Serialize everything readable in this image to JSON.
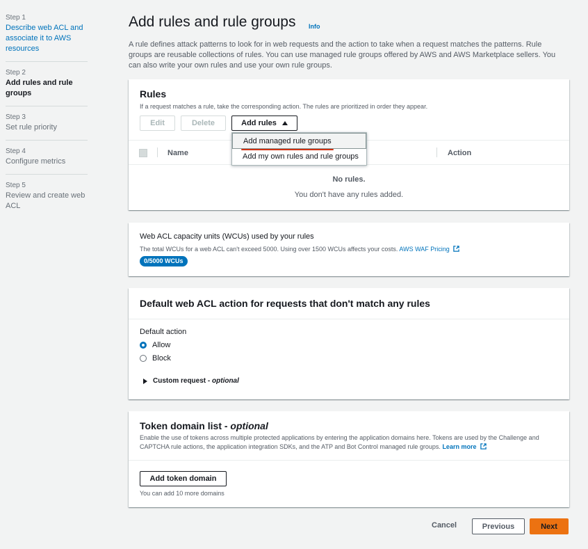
{
  "sidebar": {
    "steps": [
      {
        "num": "Step 1",
        "label": "Describe web ACL and associate it to AWS resources"
      },
      {
        "num": "Step 2",
        "label": "Add rules and rule groups"
      },
      {
        "num": "Step 3",
        "label": "Set rule priority"
      },
      {
        "num": "Step 4",
        "label": "Configure metrics"
      },
      {
        "num": "Step 5",
        "label": "Review and create web ACL"
      }
    ]
  },
  "header": {
    "title": "Add rules and rule groups",
    "info": "Info",
    "description": "A rule defines attack patterns to look for in web requests and the action to take when a request matches the patterns. Rule groups are reusable collections of rules. You can use managed rule groups offered by AWS and AWS Marketplace sellers. You can also write your own rules and use your own rule groups."
  },
  "rules": {
    "title": "Rules",
    "description": "If a request matches a rule, take the corresponding action. The rules are prioritized in order they appear.",
    "edit_label": "Edit",
    "delete_label": "Delete",
    "add_rules_label": "Add rules",
    "columns": {
      "name": "Name",
      "action": "Action"
    },
    "empty_title": "No rules.",
    "empty_subtitle": "You don't have any rules added.",
    "dropdown": [
      "Add managed rule groups",
      "Add my own rules and rule groups"
    ]
  },
  "wcu": {
    "title": "Web ACL capacity units (WCUs) used by your rules",
    "description": "The total WCUs for a web ACL can't exceed 5000. Using over 1500 WCUs affects your costs.",
    "pricing_link": "AWS WAF Pricing",
    "badge": "0/5000 WCUs"
  },
  "default_action": {
    "title": "Default web ACL action for requests that don't match any rules",
    "label": "Default action",
    "options": [
      "Allow",
      "Block"
    ],
    "selected": "Allow",
    "custom_request": "Custom request - ",
    "custom_request_optional": "optional"
  },
  "token": {
    "title": "Token domain list - ",
    "title_optional": "optional",
    "description": "Enable the use of tokens across multiple protected applications by entering the application domains here. Tokens are used by the Challenge and CAPTCHA rule actions, the application integration SDKs, and the ATP and Bot Control managed rule groups.",
    "learn_more": "Learn more",
    "add_button": "Add token domain",
    "note": "You can add 10 more domains"
  },
  "footer": {
    "cancel": "Cancel",
    "previous": "Previous",
    "next": "Next"
  },
  "colors": {
    "link": "#0073bb",
    "primary_button": "#ec7211",
    "highlight_underline": "#d13212",
    "background": "#f2f3f3"
  }
}
